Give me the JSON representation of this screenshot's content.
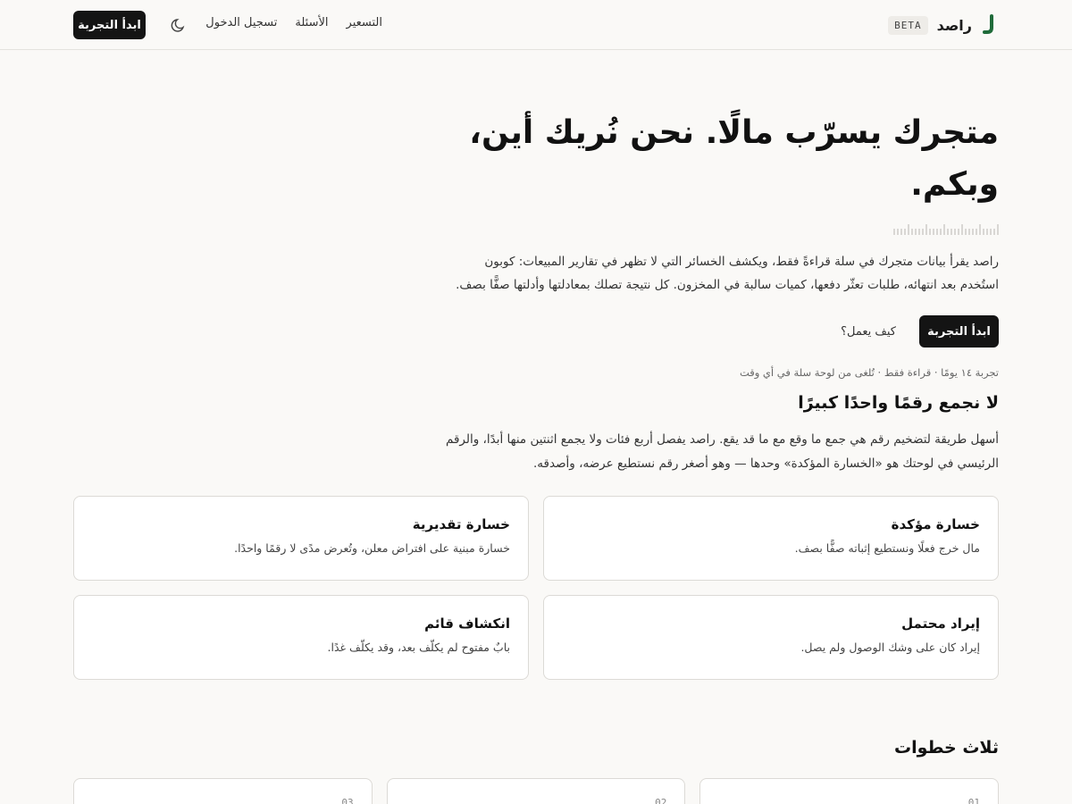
{
  "header": {
    "brand_name": "راصد",
    "beta": "BETA",
    "nav": [
      "التسعير",
      "الأسئلة",
      "تسجيل الدخول"
    ],
    "cta": "ابدأ التجربة",
    "brand_color": "#1f6b3a",
    "theme_icon": "moon-icon"
  },
  "hero": {
    "title": "متجرك يسرّب مالًا. نحن نُريك أين، وبكم.",
    "description": "راصد يقرأ بيانات متجرك في سلة قراءةً فقط، ويكشف الخسائر التي لا تظهر في تقارير المبيعات: كوبون استُخدم بعد انتهائه، طلبات تعثّر دفعها، كميات سالبة في المخزون. كل نتيجة تصلك بمعادلتها وأدلتها صفًّا بصف.",
    "cta": "ابدأ التجربة",
    "how_link": "كيف يعمل؟",
    "note": "تجربة ١٤ يومًا · قراءة فقط · تُلغى من لوحة سلة في أي وقت"
  },
  "categories": {
    "title": "لا نجمع رقمًا واحدًا كبيرًا",
    "description": "أسهل طريقة لتضخيم رقم هي جمع ما وقع مع ما قد يقع. راصد يفصل أربع فئات ولا يجمع اثنتين منها أبدًا، والرقم الرئيسي في لوحتك هو «الخسارة المؤكدة» وحدها — وهو أصغر رقم نستطيع عرضه، وأصدقه.",
    "cards": [
      {
        "title": "خسارة مؤكدة",
        "desc": "مال خرج فعلًا ونستطيع إثباته صفًّا بصف."
      },
      {
        "title": "خسارة تقديرية",
        "desc": "خسارة مبنية على افتراض معلن، وتُعرض مدًى لا رقمًا واحدًا."
      },
      {
        "title": "إيراد محتمل",
        "desc": "إيراد كان على وشك الوصول ولم يصل."
      },
      {
        "title": "انكشاف قائم",
        "desc": "بابٌ مفتوح لم يكلّف بعد، وقد يكلّف غدًا."
      }
    ]
  },
  "steps": {
    "title": "ثلاث خطوات",
    "numbers": [
      "01",
      "02",
      "03"
    ]
  }
}
